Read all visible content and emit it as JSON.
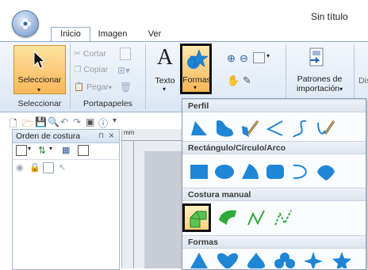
{
  "window": {
    "title": "Sin título"
  },
  "tabs": [
    {
      "label": "Inicio"
    },
    {
      "label": "Imagen"
    },
    {
      "label": "Ver"
    }
  ],
  "ribbon": {
    "seleccionar": "Seleccionar",
    "cortar": "Cortar",
    "copiar": "Copiar",
    "pegar": "Pegar",
    "texto": "Texto",
    "formas": "Formas",
    "patrones_line1": "Patrones de",
    "patrones_line2": "importación",
    "dis": "Dis",
    "groups": {
      "seleccionar": "Seleccionar",
      "portapapeles": "Portapapeles"
    }
  },
  "panel": {
    "title": "Orden de costura",
    "pin": "⊓",
    "close": "×",
    "sewing_label": "mm"
  },
  "gallery": {
    "sections": [
      {
        "label": "Perfil"
      },
      {
        "label": "Rectángulo/Círculo/Arco"
      },
      {
        "label": "Costura manual"
      },
      {
        "label": "Formas"
      }
    ]
  },
  "colors": {
    "accent": "#f9b75a",
    "shape_fill": "#1f86d6",
    "manual_green": "#2fa93a",
    "ribbon_bg": "#dbe6f3"
  }
}
